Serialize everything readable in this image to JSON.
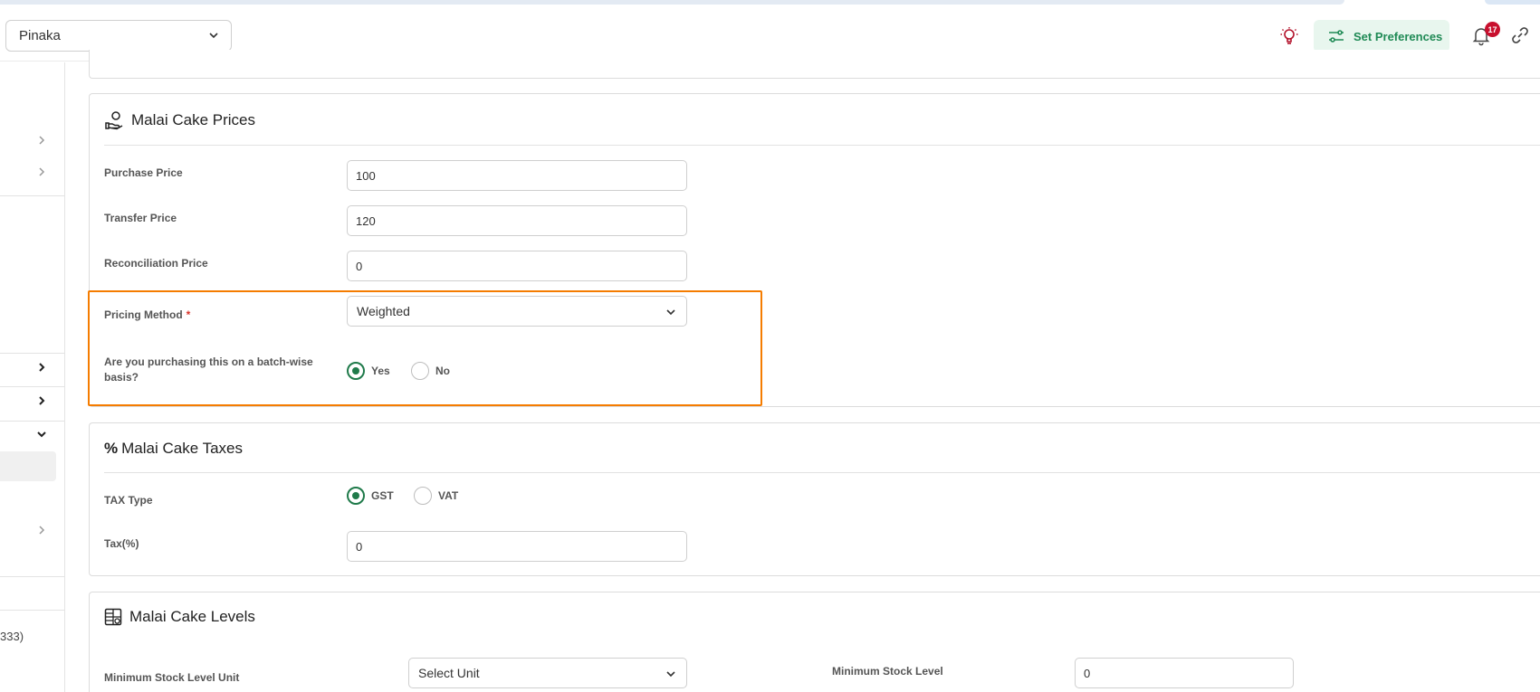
{
  "header": {
    "branch_select": "Pinaka",
    "set_preferences_label": "Set Preferences",
    "notification_count": "17"
  },
  "sidebar": {
    "partial_text": "333)"
  },
  "prices": {
    "title": "Malai Cake Prices",
    "purchase_price_label": "Purchase Price",
    "purchase_price_value": "100",
    "transfer_price_label": "Transfer Price",
    "transfer_price_value": "120",
    "reconciliation_price_label": "Reconciliation Price",
    "reconciliation_price_value": "0",
    "pricing_method_label": "Pricing Method",
    "pricing_method_required": "*",
    "pricing_method_value": "Weighted",
    "batch_label_line1": "Are you purchasing this on a batch-wise",
    "batch_label_line2": "basis?",
    "batch_yes": "Yes",
    "batch_no": "No",
    "batch_selected": "Yes"
  },
  "taxes": {
    "title_symbol": "%",
    "title": "Malai Cake Taxes",
    "tax_type_label": "TAX Type",
    "tax_gst": "GST",
    "tax_vat": "VAT",
    "tax_selected": "GST",
    "tax_percent_label": "Tax(%)",
    "tax_percent_value": "0"
  },
  "levels": {
    "title": "Malai Cake Levels",
    "min_stock_unit_label": "Minimum Stock Level Unit",
    "min_stock_unit_value": "Select Unit",
    "min_stock_level_label": "Minimum Stock Level",
    "min_stock_level_value": "0"
  },
  "colors": {
    "accent_green": "#1f7a4a",
    "highlight_orange": "#f57c00",
    "badge_red": "#c8102e"
  }
}
